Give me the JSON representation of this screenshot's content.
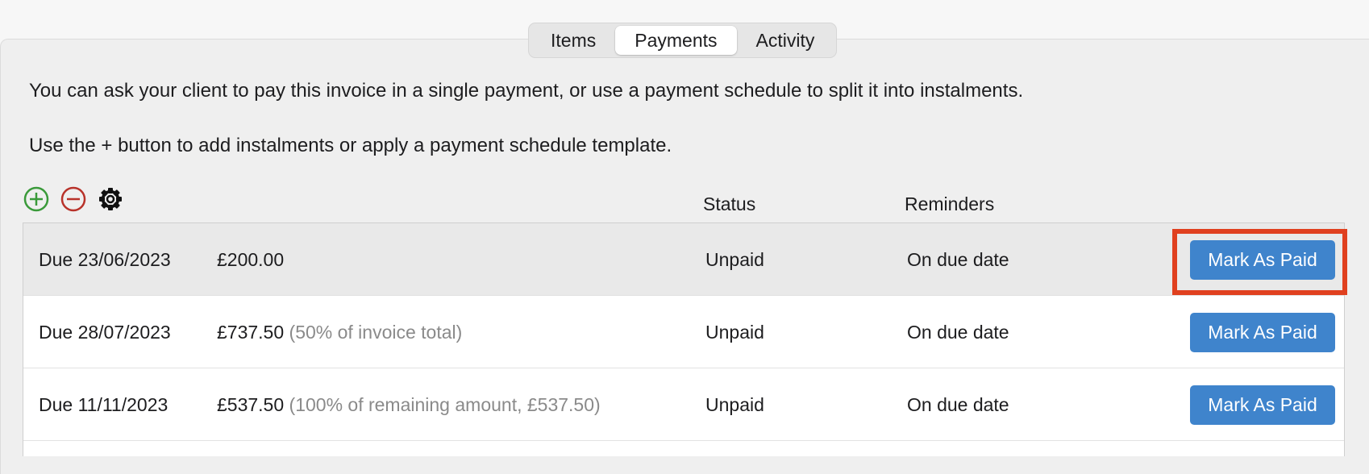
{
  "tabs": [
    {
      "label": "Items",
      "active": false
    },
    {
      "label": "Payments",
      "active": true
    },
    {
      "label": "Activity",
      "active": false
    }
  ],
  "description": {
    "line1": "You can ask your client to pay this invoice in a single payment, or use a payment schedule to split it into instalments.",
    "line2": "Use the + button to add instalments or apply a payment schedule template."
  },
  "toolbar": {
    "add_icon": "plus-circle-icon",
    "remove_icon": "minus-circle-icon",
    "settings_icon": "gear-icon"
  },
  "columns": {
    "status": "Status",
    "reminders": "Reminders"
  },
  "payments": [
    {
      "due": "Due 23/06/2023",
      "amount": "£200.00",
      "note": "",
      "status": "Unpaid",
      "reminder": "On due date",
      "action": "Mark As Paid",
      "selected": true
    },
    {
      "due": "Due 28/07/2023",
      "amount": "£737.50",
      "note": "(50% of invoice total)",
      "status": "Unpaid",
      "reminder": "On due date",
      "action": "Mark As Paid",
      "selected": false
    },
    {
      "due": "Due 11/11/2023",
      "amount": "£537.50",
      "note": "(100% of remaining amount, £537.50)",
      "status": "Unpaid",
      "reminder": "On due date",
      "action": "Mark As Paid",
      "selected": false
    }
  ],
  "colors": {
    "accent_button": "#3f84cc",
    "add_green": "#3a9a3a",
    "remove_red": "#b8322a",
    "highlight_red": "#e0401f"
  }
}
